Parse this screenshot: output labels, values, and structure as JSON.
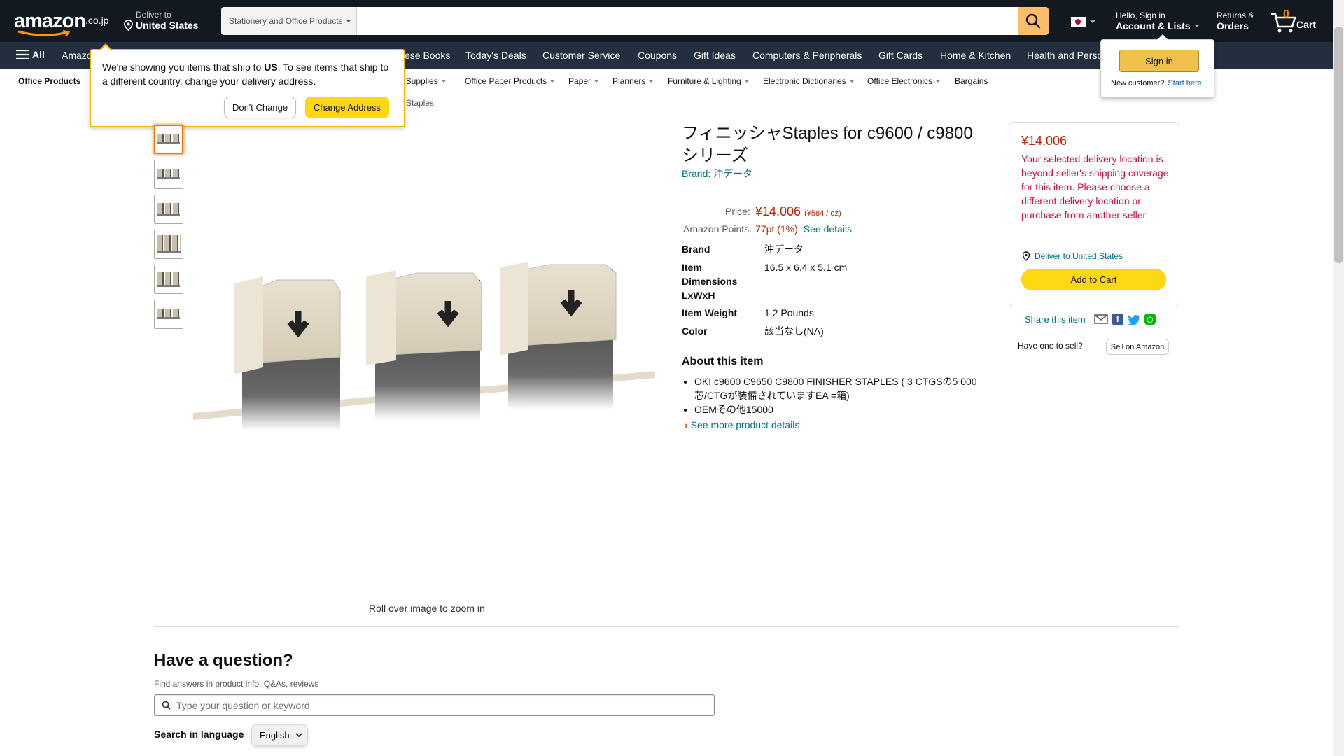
{
  "header": {
    "logo_text": "amazon",
    "logo_tld": ".co.jp",
    "deliver_line1": "Deliver to",
    "deliver_line2": "United States",
    "search_category": "Stationery and Office Products",
    "search_placeholder": "",
    "account_line1": "Hello, Sign in",
    "account_line2": "Account & Lists",
    "returns_line1": "Returns &",
    "returns_line2": "Orders",
    "cart_count": "0",
    "cart_label": "Cart"
  },
  "nav": {
    "all_label": "All",
    "items": [
      "Amazon",
      "ese Books",
      "Today's Deals",
      "Customer Service",
      "Coupons",
      "Gift Ideas",
      "Computers & Peripherals",
      "Gift Cards",
      "Home & Kitchen",
      "Health and Perso"
    ]
  },
  "subnav": {
    "items": [
      "Office Products",
      ", Supplies",
      "Office Paper Products",
      "Paper",
      "Planners",
      "Furniture & Lighting",
      "Electronic Dictionaries",
      "Office Electronics",
      "Bargains"
    ]
  },
  "address_popover": {
    "text_before": "We're showing you items that ship to ",
    "text_country": "US",
    "text_after": ". To see items that ship to a different country, change your delivery address.",
    "dont_change": "Don't Change",
    "change_address": "Change Address"
  },
  "signin_popover": {
    "button": "Sign in",
    "new_customer": "New customer?",
    "start_here": "Start here."
  },
  "breadcrumb_tail": "Staples",
  "gallery": {
    "roll_over": "Roll over image to zoom in"
  },
  "product": {
    "title": "フィニッシャStaples for c9600 / c9800 シリーズ",
    "brand_link": "Brand: 沖データ",
    "price_label": "Price:",
    "price": "¥14,006",
    "unit_price": "(¥584 / oz)",
    "points_label": "Amazon Points:",
    "points": "77pt  (1%)",
    "points_link": "See details",
    "specs": [
      {
        "k": "Brand",
        "v": "沖データ"
      },
      {
        "k": "Item Dimensions LxWxH",
        "v": "16.5 x 6.4 x 5.1 cm"
      },
      {
        "k": "Item Weight",
        "v": "1.2 Pounds"
      },
      {
        "k": "Color",
        "v": "該当なし(NA)"
      }
    ],
    "about_heading": "About this item",
    "about": [
      "OKI c9600 C9650 C9800 FINISHER STAPLES ( 3 CTGSの5 000芯/CTGが装備されていますEA =箱)",
      "OEMその他15000"
    ],
    "see_more": "See more product details"
  },
  "buybox": {
    "price": "¥14,006",
    "warning": "Your selected delivery location is beyond seller's shipping coverage for this item. Please choose a different delivery location or purchase from another seller.",
    "deliver_to": "Deliver to United States",
    "add_to_cart": "Add to Cart",
    "share": "Share this item",
    "have_one": "Have one to sell?",
    "sell_btn": "Sell on Amazon"
  },
  "questions": {
    "heading": "Have a question?",
    "sub": "Find answers in product info, Q&As, reviews",
    "placeholder": "Type your question or keyword",
    "lang_label": "Search in language",
    "lang_value": "English"
  },
  "colors": {
    "nav_bg": "#131921",
    "nav_main_bg": "#232f3e",
    "accent": "#febd69",
    "price": "#b12704",
    "link": "#007185",
    "button_yellow": "#ffd814"
  }
}
